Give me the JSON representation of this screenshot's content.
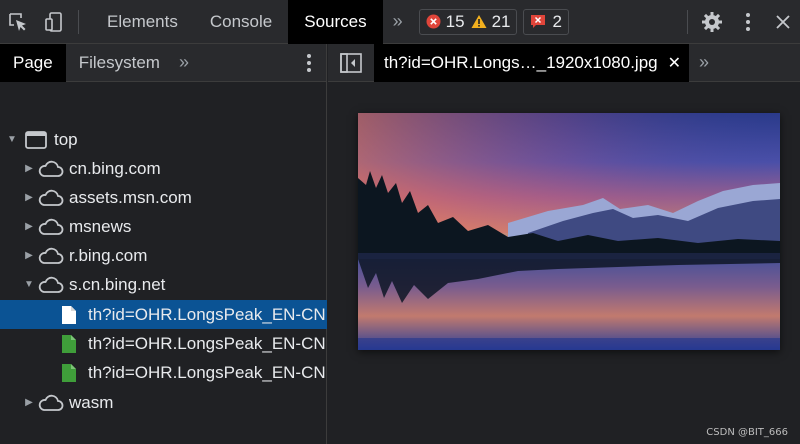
{
  "toolbar": {
    "tabs": [
      "Elements",
      "Console",
      "Sources"
    ],
    "active_tab": "Sources",
    "errors": "15",
    "warnings": "21",
    "issues": "2"
  },
  "left": {
    "subtabs": [
      "Page",
      "Filesystem"
    ],
    "tree": {
      "top": "top",
      "domains": [
        "cn.bing.com",
        "assets.msn.com",
        "msnews",
        "r.bing.com",
        "s.cn.bing.net",
        "wasm"
      ],
      "files": [
        "th?id=OHR.LongsPeak_EN-CN",
        "th?id=OHR.LongsPeak_EN-CN",
        "th?id=OHR.LongsPeak_EN-CN"
      ]
    }
  },
  "right": {
    "open_file": "th?id=OHR.Longs…_1920x1080.jpg"
  },
  "watermark": "CSDN @BIT_666",
  "colors": {
    "selection": "#0b5394",
    "error": "#e0453a",
    "warning": "#f2b01e",
    "file_green": "#3f9e3a"
  }
}
